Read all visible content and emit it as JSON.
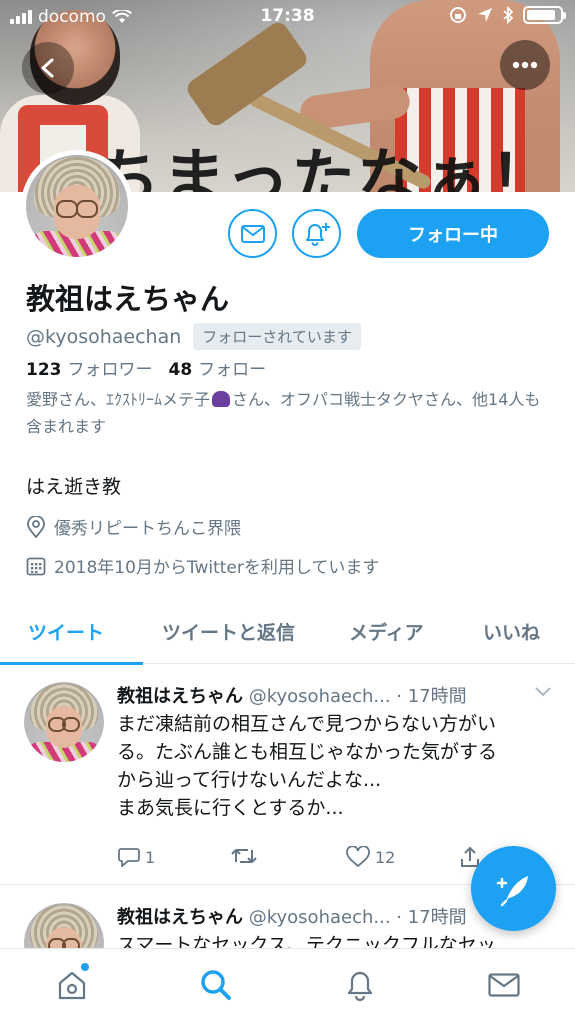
{
  "status_bar": {
    "carrier": "docomo",
    "time": "17:38"
  },
  "profile": {
    "name": "教祖はえちゃん",
    "handle": "@kyosohaechan",
    "follows_you_badge": "フォローされています",
    "follow_button_label": "フォロー中",
    "followers_count": "123",
    "followers_label": "フォロワー",
    "following_count": "48",
    "following_label": "フォロー",
    "followed_by_part1": "愛野さん、ｴｸｽﾄﾘｰﾑメテ子",
    "followed_by_part2": "さん、オフパコ戦士タクヤさん、他14人も含まれます",
    "bio": "はえ逝き教",
    "location": "優秀リピートちんこ界隈",
    "joined": "2018年10月からTwitterを利用しています",
    "banner_text": "ぅちまったなぁ！"
  },
  "tabs": [
    {
      "label": "ツイート",
      "active": true
    },
    {
      "label": "ツイートと返信",
      "active": false
    },
    {
      "label": "メディア",
      "active": false
    },
    {
      "label": "いいね",
      "active": false
    }
  ],
  "tweets": [
    {
      "name": "教祖はえちゃん",
      "meta": "@kyosohaech... · 17時間",
      "lines": [
        "まだ凍結前の相互さんで見つからない方がい",
        "る。たぶん誰とも相互じゃなかった気がする",
        "から辿って行けないんだよな...",
        "まあ気長に行くとするか..."
      ],
      "replies": "1",
      "retweets": "",
      "likes": "12"
    },
    {
      "name": "教祖はえちゃん",
      "meta": "@kyosohaech... · 17時間",
      "lines": [
        "スマートなセックス、テクニックフルなセッ"
      ]
    }
  ],
  "colors": {
    "accent": "#1da1f2",
    "muted": "#657786",
    "text": "#14171a"
  }
}
